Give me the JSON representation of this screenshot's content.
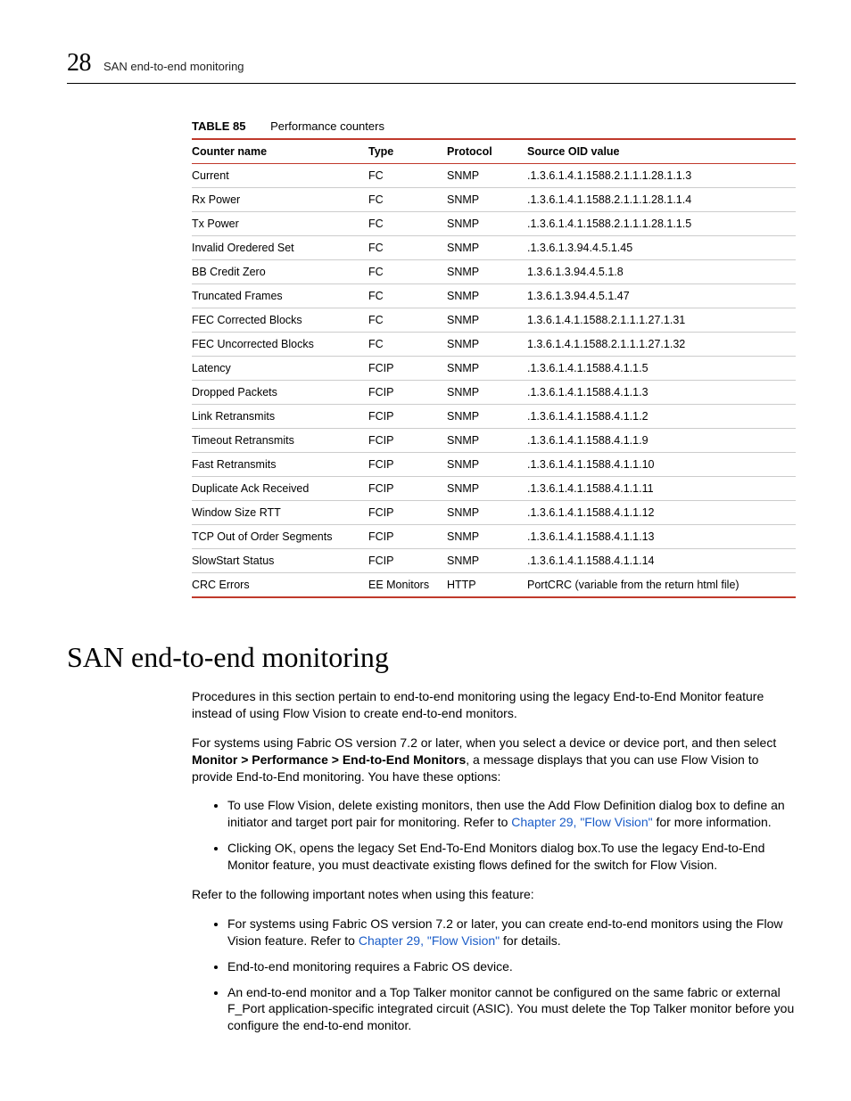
{
  "header": {
    "chapter_number": "28",
    "running_title": "SAN end-to-end monitoring"
  },
  "table": {
    "label": "TABLE 85",
    "title": "Performance counters",
    "columns": [
      "Counter name",
      "Type",
      "Protocol",
      "Source OID value"
    ],
    "rows": [
      {
        "name": "Current",
        "type": "FC",
        "protocol": "SNMP",
        "oid": ".1.3.6.1.4.1.1588.2.1.1.1.28.1.1.3"
      },
      {
        "name": "Rx Power",
        "type": "FC",
        "protocol": "SNMP",
        "oid": ".1.3.6.1.4.1.1588.2.1.1.1.28.1.1.4"
      },
      {
        "name": "Tx Power",
        "type": "FC",
        "protocol": "SNMP",
        "oid": ".1.3.6.1.4.1.1588.2.1.1.1.28.1.1.5"
      },
      {
        "name": "Invalid Oredered Set",
        "type": "FC",
        "protocol": "SNMP",
        "oid": ".1.3.6.1.3.94.4.5.1.45"
      },
      {
        "name": "BB Credit Zero",
        "type": "FC",
        "protocol": "SNMP",
        "oid": "1.3.6.1.3.94.4.5.1.8"
      },
      {
        "name": "Truncated Frames",
        "type": "FC",
        "protocol": "SNMP",
        "oid": "1.3.6.1.3.94.4.5.1.47"
      },
      {
        "name": "FEC Corrected Blocks",
        "type": "FC",
        "protocol": "SNMP",
        "oid": "1.3.6.1.4.1.1588.2.1.1.1.27.1.31"
      },
      {
        "name": "FEC Uncorrected Blocks",
        "type": "FC",
        "protocol": "SNMP",
        "oid": "1.3.6.1.4.1.1588.2.1.1.1.27.1.32"
      },
      {
        "name": "Latency",
        "type": "FCIP",
        "protocol": "SNMP",
        "oid": ".1.3.6.1.4.1.1588.4.1.1.5"
      },
      {
        "name": "Dropped Packets",
        "type": "FCIP",
        "protocol": "SNMP",
        "oid": ".1.3.6.1.4.1.1588.4.1.1.3"
      },
      {
        "name": "Link Retransmits",
        "type": "FCIP",
        "protocol": "SNMP",
        "oid": ".1.3.6.1.4.1.1588.4.1.1.2"
      },
      {
        "name": "Timeout Retransmits",
        "type": "FCIP",
        "protocol": "SNMP",
        "oid": ".1.3.6.1.4.1.1588.4.1.1.9"
      },
      {
        "name": "Fast Retransmits",
        "type": "FCIP",
        "protocol": "SNMP",
        "oid": ".1.3.6.1.4.1.1588.4.1.1.10"
      },
      {
        "name": "Duplicate Ack Received",
        "type": "FCIP",
        "protocol": "SNMP",
        "oid": ".1.3.6.1.4.1.1588.4.1.1.11"
      },
      {
        "name": "Window Size RTT",
        "type": "FCIP",
        "protocol": "SNMP",
        "oid": ".1.3.6.1.4.1.1588.4.1.1.12"
      },
      {
        "name": "TCP Out of Order Segments",
        "type": "FCIP",
        "protocol": "SNMP",
        "oid": ".1.3.6.1.4.1.1588.4.1.1.13"
      },
      {
        "name": "SlowStart Status",
        "type": "FCIP",
        "protocol": "SNMP",
        "oid": ".1.3.6.1.4.1.1588.4.1.1.14"
      },
      {
        "name": "CRC Errors",
        "type": "EE Monitors",
        "protocol": "HTTP",
        "oid": "PortCRC (variable from the return html file)"
      }
    ]
  },
  "section": {
    "heading": "SAN end-to-end monitoring",
    "para1": "Procedures in this section pertain to end-to-end monitoring using the legacy End-to-End Monitor feature instead of using Flow Vision to create end-to-end monitors.",
    "para2_a": "For systems using Fabric OS version 7.2 or later, when you select a device or device port, and then select ",
    "para2_bold": "Monitor > Performance > End-to-End Monitors",
    "para2_b": ", a message displays that you can use Flow Vision to provide End-to-End monitoring. You have these options:",
    "bullets1": {
      "b1_a": "To use Flow Vision, delete existing monitors, then use the ",
      "b1_bold": "Add Flow Definition",
      "b1_b": " dialog box to define an initiator and target port pair for monitoring. Refer to ",
      "b1_link": "Chapter 29, \"Flow Vision\"",
      "b1_c": " for more information.",
      "b2_a": "Clicking ",
      "b2_bold1": "OK",
      "b2_b": ", opens the legacy ",
      "b2_bold2": "Set End-To-End Monitors",
      "b2_c": " dialog box.To use the legacy End-to-End Monitor feature, you must deactivate existing flows defined for the switch for Flow Vision."
    },
    "para3": "Refer to the following important notes when using this feature:",
    "bullets2": {
      "b1_a": "For systems using Fabric OS version 7.2 or later, you can create end-to-end monitors using the Flow Vision feature. Refer to ",
      "b1_link": "Chapter 29, \"Flow Vision\"",
      "b1_b": " for details.",
      "b2": "End-to-end monitoring requires a Fabric OS device.",
      "b3": "An end-to-end monitor and a Top Talker monitor cannot be configured on the same fabric or external F_Port application-specific integrated circuit (ASIC). You must delete the Top Talker monitor before you configure the end-to-end monitor."
    }
  }
}
